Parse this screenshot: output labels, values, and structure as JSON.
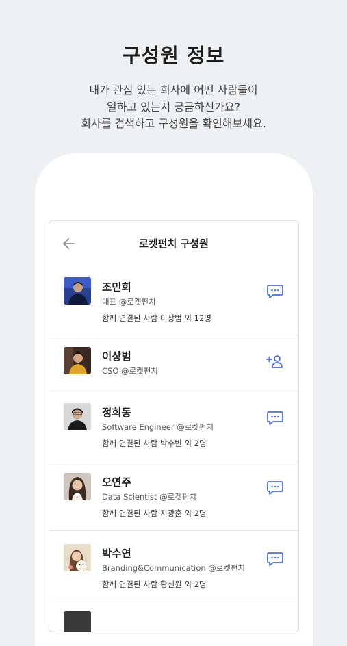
{
  "hero": {
    "title": "구성원 정보",
    "description_lines": [
      "내가 관심 있는 회사에 어떤 사람들이",
      "일하고 있는지 궁금하신가요?",
      "회사를 검색하고 구성원을 확인해보세요."
    ]
  },
  "screen": {
    "back_icon": "arrow-left-icon",
    "title": "로켓펀치 구성원",
    "accent_color": "#4e6fd8",
    "members": [
      {
        "name": "조민희",
        "role": "대표 @로켓펀치",
        "mutual": "함께 연결된 사람 이상범 외 12명",
        "action_icon": "chat-icon"
      },
      {
        "name": "이상범",
        "role": "CSO @로켓펀치",
        "mutual": "",
        "action_icon": "add-person-icon"
      },
      {
        "name": "정희동",
        "role": "Software Engineer @로켓펀치",
        "mutual": "함께 연결된 사람 박수빈 외 2명",
        "action_icon": "chat-icon"
      },
      {
        "name": "오연주",
        "role": "Data Scientist @로켓펀치",
        "mutual": "함께 연결된 사람 지광훈 외 2명",
        "action_icon": "chat-icon"
      },
      {
        "name": "박수연",
        "role": "Branding&Communication @로켓펀치",
        "mutual": "함께 연결된 사람 황신원 외 2명",
        "action_icon": "chat-icon"
      }
    ]
  }
}
